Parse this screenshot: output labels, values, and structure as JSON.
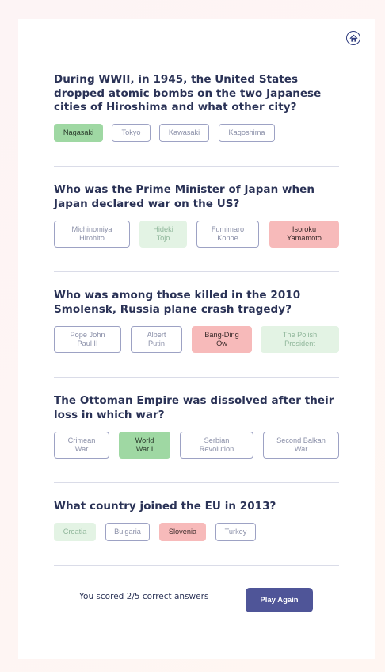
{
  "quiz": {
    "questions": [
      {
        "text": "During WWII, in 1945, the United States dropped atomic bombs on the two Japanese cities of Hiroshima and what other city?",
        "answers": [
          {
            "label": "Nagasaki",
            "state": "correct-chosen"
          },
          {
            "label": "Tokyo",
            "state": "neutral"
          },
          {
            "label": "Kawasaki",
            "state": "neutral"
          },
          {
            "label": "Kagoshima",
            "state": "neutral"
          }
        ]
      },
      {
        "text": "Who was the Prime Minister of Japan when Japan declared war on the US?",
        "answers": [
          {
            "label": "Michinomiya\nHirohito",
            "state": "neutral"
          },
          {
            "label": "Hideki\nTojo",
            "state": "correct-missed"
          },
          {
            "label": "Fumimaro\nKonoe",
            "state": "neutral"
          },
          {
            "label": "Isoroku\nYamamoto",
            "state": "wrong"
          }
        ]
      },
      {
        "text": "Who was among those killed in the 2010 Smolensk, Russia plane crash tragedy?",
        "answers": [
          {
            "label": "Pope John\nPaul II",
            "state": "neutral"
          },
          {
            "label": "Albert\nPutin",
            "state": "neutral"
          },
          {
            "label": "Bang-Ding\nOw",
            "state": "wrong"
          },
          {
            "label": "The Polish\nPresident",
            "state": "correct-missed"
          }
        ]
      },
      {
        "text": "The Ottoman Empire was dissolved after their loss in which war?",
        "answers": [
          {
            "label": "Crimean\nWar",
            "state": "neutral"
          },
          {
            "label": "World\nWar I",
            "state": "correct-chosen"
          },
          {
            "label": "Serbian\nRevolution",
            "state": "neutral"
          },
          {
            "label": "Second Balkan\nWar",
            "state": "neutral"
          }
        ]
      },
      {
        "text": "What country joined the EU in 2013?",
        "answers": [
          {
            "label": "Croatia",
            "state": "correct-missed"
          },
          {
            "label": "Bulgaria",
            "state": "neutral"
          },
          {
            "label": "Slovenia",
            "state": "wrong"
          },
          {
            "label": "Turkey",
            "state": "neutral"
          }
        ]
      }
    ]
  },
  "result": {
    "score_text": "You scored 2/5 correct answers",
    "play_again_label": "Play Again"
  },
  "icons": {
    "home": "home-icon"
  },
  "colors": {
    "accent": "#4f5598",
    "correct": "#9fd8a3",
    "correct_light": "#e3f3e4",
    "wrong": "#f7baba",
    "text": "#2a3256"
  }
}
